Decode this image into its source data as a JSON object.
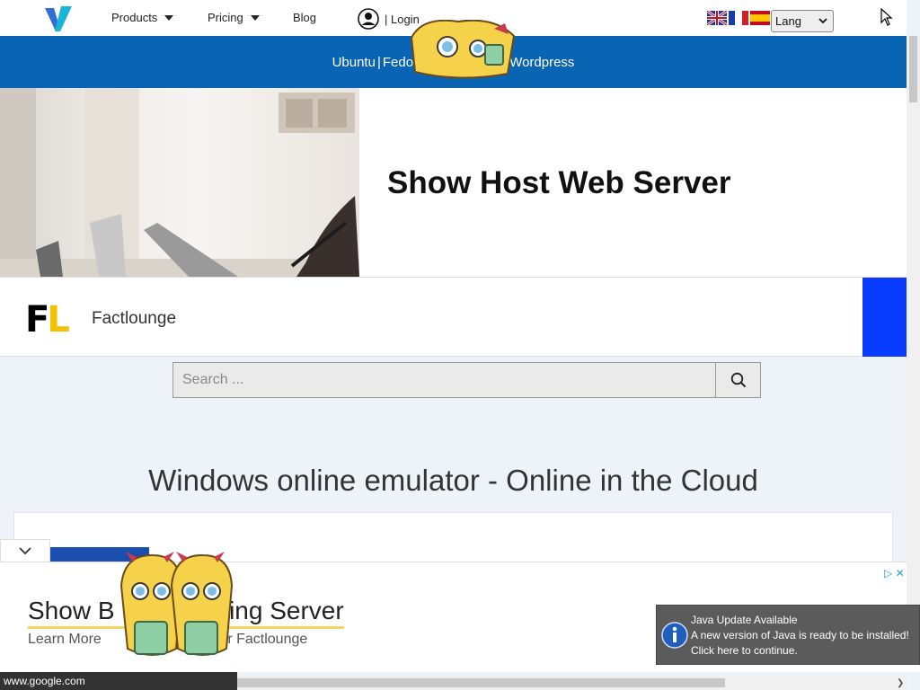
{
  "nav": {
    "products": "Products",
    "pricing": "Pricing",
    "blog": "Blog",
    "login": "| Login",
    "lang": "Lang"
  },
  "bluebar": {
    "ubuntu": "Ubuntu",
    "sep1": "|",
    "fedora": "Fedora",
    "sep2": "|",
    "hidden": "",
    "sep3": "|",
    "wordpress": "Wordpress"
  },
  "hero": {
    "title": "Show Host Web Server"
  },
  "brand": {
    "logo_f": "F",
    "logo_l": "L",
    "name": "Factlounge"
  },
  "search": {
    "placeholder": "Search ..."
  },
  "heading": "Windows online emulator - Online in the Cloud",
  "ad": {
    "title": "Show B         Hosting Server",
    "subtitle": "Learn More         Hosting Server Factlounge",
    "choices": "▷ ✕"
  },
  "java": {
    "line1": "Java Update Available",
    "line2": "A new version of Java is ready to be installed!",
    "line3": "Click here to continue."
  },
  "status": {
    "url": "www.google.com"
  },
  "colors": {
    "primary_blue": "#0a64b4",
    "brand_blue": "#0a3cff",
    "logo_yellow": "#f2c200"
  }
}
